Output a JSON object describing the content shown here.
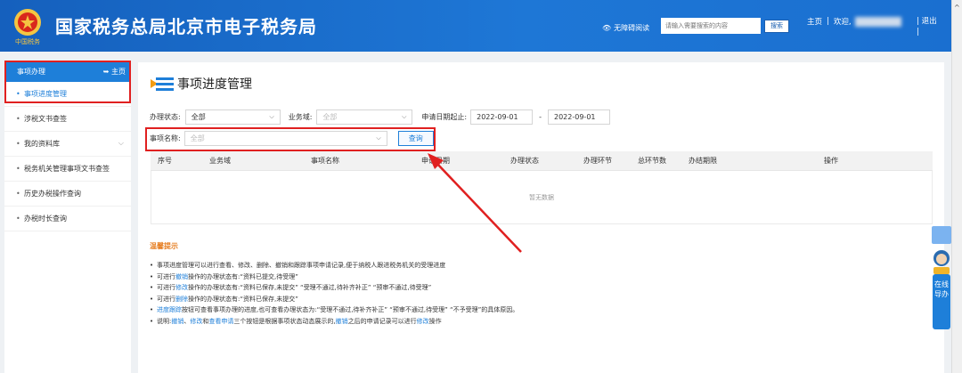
{
  "header": {
    "site_title": "国家税务总局北京市电子税务局",
    "emblem_text": "中国税务",
    "accessibility_label": "无障碍阅读",
    "search_placeholder": "请输入需要搜索的内容",
    "search_button": "搜索",
    "home_link": "主页",
    "welcome": "欢迎,",
    "logout": "退出"
  },
  "sidebar": {
    "title": "事项办理",
    "home": "主页",
    "items": [
      {
        "label": "事项进度管理"
      },
      {
        "label": "涉税文书查签"
      },
      {
        "label": "我的资料库"
      },
      {
        "label": "税务机关管理事项文书查签"
      },
      {
        "label": "历史办税操作查询"
      },
      {
        "label": "办税时长查询"
      }
    ]
  },
  "main": {
    "page_title": "事项进度管理",
    "filters": {
      "status_label": "办理状态:",
      "status_value": "全部",
      "domain_label": "业务域:",
      "domain_value": "全部",
      "date_label": "申请日期起止:",
      "date_from": "2022-09-01",
      "date_sep": "-",
      "date_to": "2022-09-01",
      "name_label": "事项名称:",
      "name_value": "全部",
      "query_button": "查询"
    },
    "table": {
      "columns": [
        "序号",
        "业务域",
        "事项名称",
        "申请日期",
        "办理状态",
        "办理环节",
        "总环节数",
        "办结期限",
        "操作"
      ],
      "empty_text": "暂无数据"
    },
    "tips": {
      "title": "温馨提示",
      "line1": "事项进度管理可以进行查看、修改、删除、撤销和跟踪事项申请记录,便于纳税人跟进税务机关的受理进度",
      "line2_a": "可进行",
      "line2_b": "撤销",
      "line2_c": "操作的办理状态有:“资料已提交,待受理”",
      "line3_a": "可进行",
      "line3_b": "修改",
      "line3_c": "操作的办理状态有:“资料已保存,未提交” “受理不通过,待补齐补正” “预审不通过,待受理”",
      "line4_a": "可进行",
      "line4_b": "删除",
      "line4_c": "操作的办理状态有:“资料已保存,未提交”",
      "line5_a": "进度跟踪",
      "line5_b": "按钮可查看事项办理的进度,也可查看办理状态为:“受理不通过,待补齐补正” “预审不通过,待受理” “不予受理”的具体原因。",
      "line6_a": "说明:",
      "line6_b": "撤销",
      "line6_c": "、",
      "line6_d": "修改",
      "line6_e": "和",
      "line6_f": "查看申请",
      "line6_g": "三个按钮是根据事项状态动态展示的,",
      "line6_h": "撤销",
      "line6_i": "之后的申请记录可以进行",
      "line6_j": "修改",
      "line6_k": "操作"
    }
  },
  "guide": {
    "label": "在线导办"
  },
  "colors": {
    "header_blue": "#1565c0",
    "accent_blue": "#1e7fd9",
    "annotation_red": "#e02020",
    "tips_orange": "#e67e22"
  }
}
